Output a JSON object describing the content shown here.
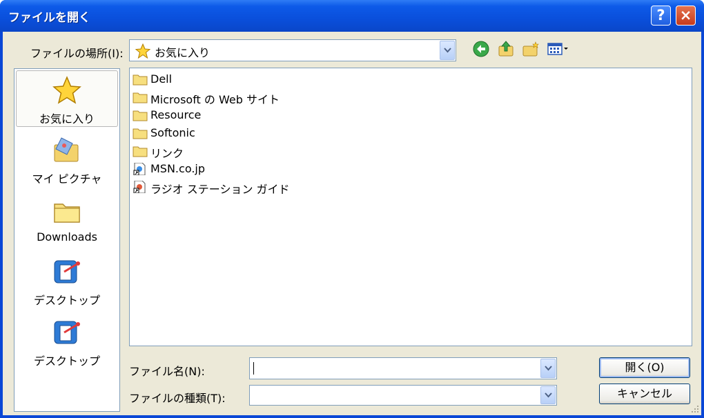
{
  "window": {
    "title": "ファイルを開く",
    "help_icon": "?",
    "close_icon": "×"
  },
  "lookin": {
    "label": "ファイルの場所(I):",
    "value": "お気に入り"
  },
  "toolbar": {
    "back": "back-icon",
    "up": "up-folder-icon",
    "new_folder": "new-folder-icon",
    "views": "views-menu-icon"
  },
  "places": [
    {
      "label": "お気に入り",
      "icon": "favorites-star-icon",
      "selected": true
    },
    {
      "label": "マイ ピクチャ",
      "icon": "my-pictures-icon"
    },
    {
      "label": "Downloads",
      "icon": "folder-icon"
    },
    {
      "label": "デスクトップ",
      "icon": "desktop-icon"
    },
    {
      "label": "デスクトップ",
      "icon": "desktop-icon"
    }
  ],
  "files": [
    {
      "name": "Dell",
      "type": "folder"
    },
    {
      "name": "Microsoft の Web サイト",
      "type": "folder"
    },
    {
      "name": "Resource",
      "type": "folder"
    },
    {
      "name": "Softonic",
      "type": "folder"
    },
    {
      "name": "リンク",
      "type": "folder"
    },
    {
      "name": "MSN.co.jp",
      "type": "shortcut"
    },
    {
      "name": "ラジオ ステーション ガイド",
      "type": "shortcut"
    }
  ],
  "filename": {
    "label": "ファイル名(N):",
    "value": ""
  },
  "filetype": {
    "label": "ファイルの種類(T):",
    "value": ""
  },
  "buttons": {
    "open": "開く(O)",
    "cancel": "キャンセル"
  },
  "colors": {
    "title_bar": "#0a4fdb",
    "dialog_bg": "#ece9d8",
    "border": "#7f9db9"
  }
}
